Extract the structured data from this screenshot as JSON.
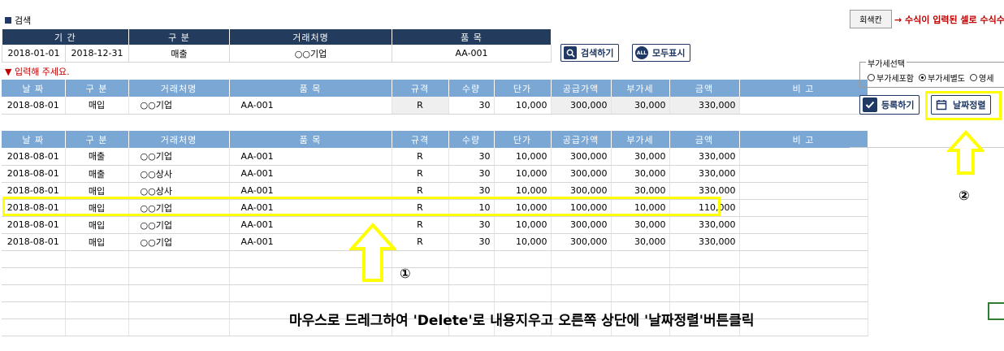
{
  "section": {
    "title": "검색"
  },
  "search": {
    "headers": [
      "기 간",
      "구 분",
      "거래처명",
      "품 목"
    ],
    "date_from": "2018-01-01",
    "date_to": "2018-12-31",
    "category": "매출",
    "vendor": "○○기업",
    "item": "AA-001"
  },
  "buttons": {
    "search": "검색하기",
    "show_all": "모두표시",
    "register": "등록하기",
    "date_sort": "날짜정렬",
    "show_all_icon_text": "ALL"
  },
  "hint": "▼ 입력해 주세요.",
  "legend": {
    "gray_cell": "회색칸",
    "note": "→ 수식이 입력된 셀로 수식수"
  },
  "vat": {
    "title": "부가세선택",
    "options": [
      "부가세포함",
      "부가세별도",
      "영세"
    ],
    "selected": "부가세별도"
  },
  "table_headers": [
    "날 짜",
    "구 분",
    "거래처명",
    "품 목",
    "규격",
    "수량",
    "단가",
    "공급가액",
    "부가세",
    "금액",
    "비 고"
  ],
  "input_row": [
    "2018-08-01",
    "매입",
    "○○기업",
    "AA-001",
    "R",
    "30",
    "10,000",
    "300,000",
    "30,000",
    "330,000",
    ""
  ],
  "rows": [
    [
      "2018-08-01",
      "매출",
      "○○기업",
      "AA-001",
      "R",
      "30",
      "10,000",
      "300,000",
      "30,000",
      "330,000",
      ""
    ],
    [
      "2018-08-01",
      "매출",
      "○○상사",
      "AA-001",
      "R",
      "30",
      "10,000",
      "300,000",
      "30,000",
      "330,000",
      ""
    ],
    [
      "2018-08-01",
      "매입",
      "○○상사",
      "AA-001",
      "R",
      "30",
      "10,000",
      "300,000",
      "30,000",
      "330,000",
      ""
    ],
    [
      "2018-08-01",
      "매입",
      "○○기업",
      "AA-001",
      "R",
      "10",
      "10,000",
      "100,000",
      "10,000",
      "110,000",
      ""
    ],
    [
      "2018-08-01",
      "매입",
      "○○기업",
      "AA-001",
      "R",
      "30",
      "10,000",
      "300,000",
      "30,000",
      "330,000",
      ""
    ],
    [
      "2018-08-01",
      "매입",
      "○○기업",
      "AA-001",
      "R",
      "30",
      "10,000",
      "300,000",
      "30,000",
      "330,000",
      ""
    ]
  ],
  "annotations": {
    "step1": "①",
    "step2": "②",
    "instruction": "마우스로 드레그하여 'Delete'로 내용지우고 오른쪽 상단에 '날짜정렬'버튼클릭"
  },
  "colors": {
    "header_dark": "#233b5d",
    "header_light": "#7ba7d4",
    "highlight": "#ffff00",
    "hint_red": "#c00000"
  }
}
